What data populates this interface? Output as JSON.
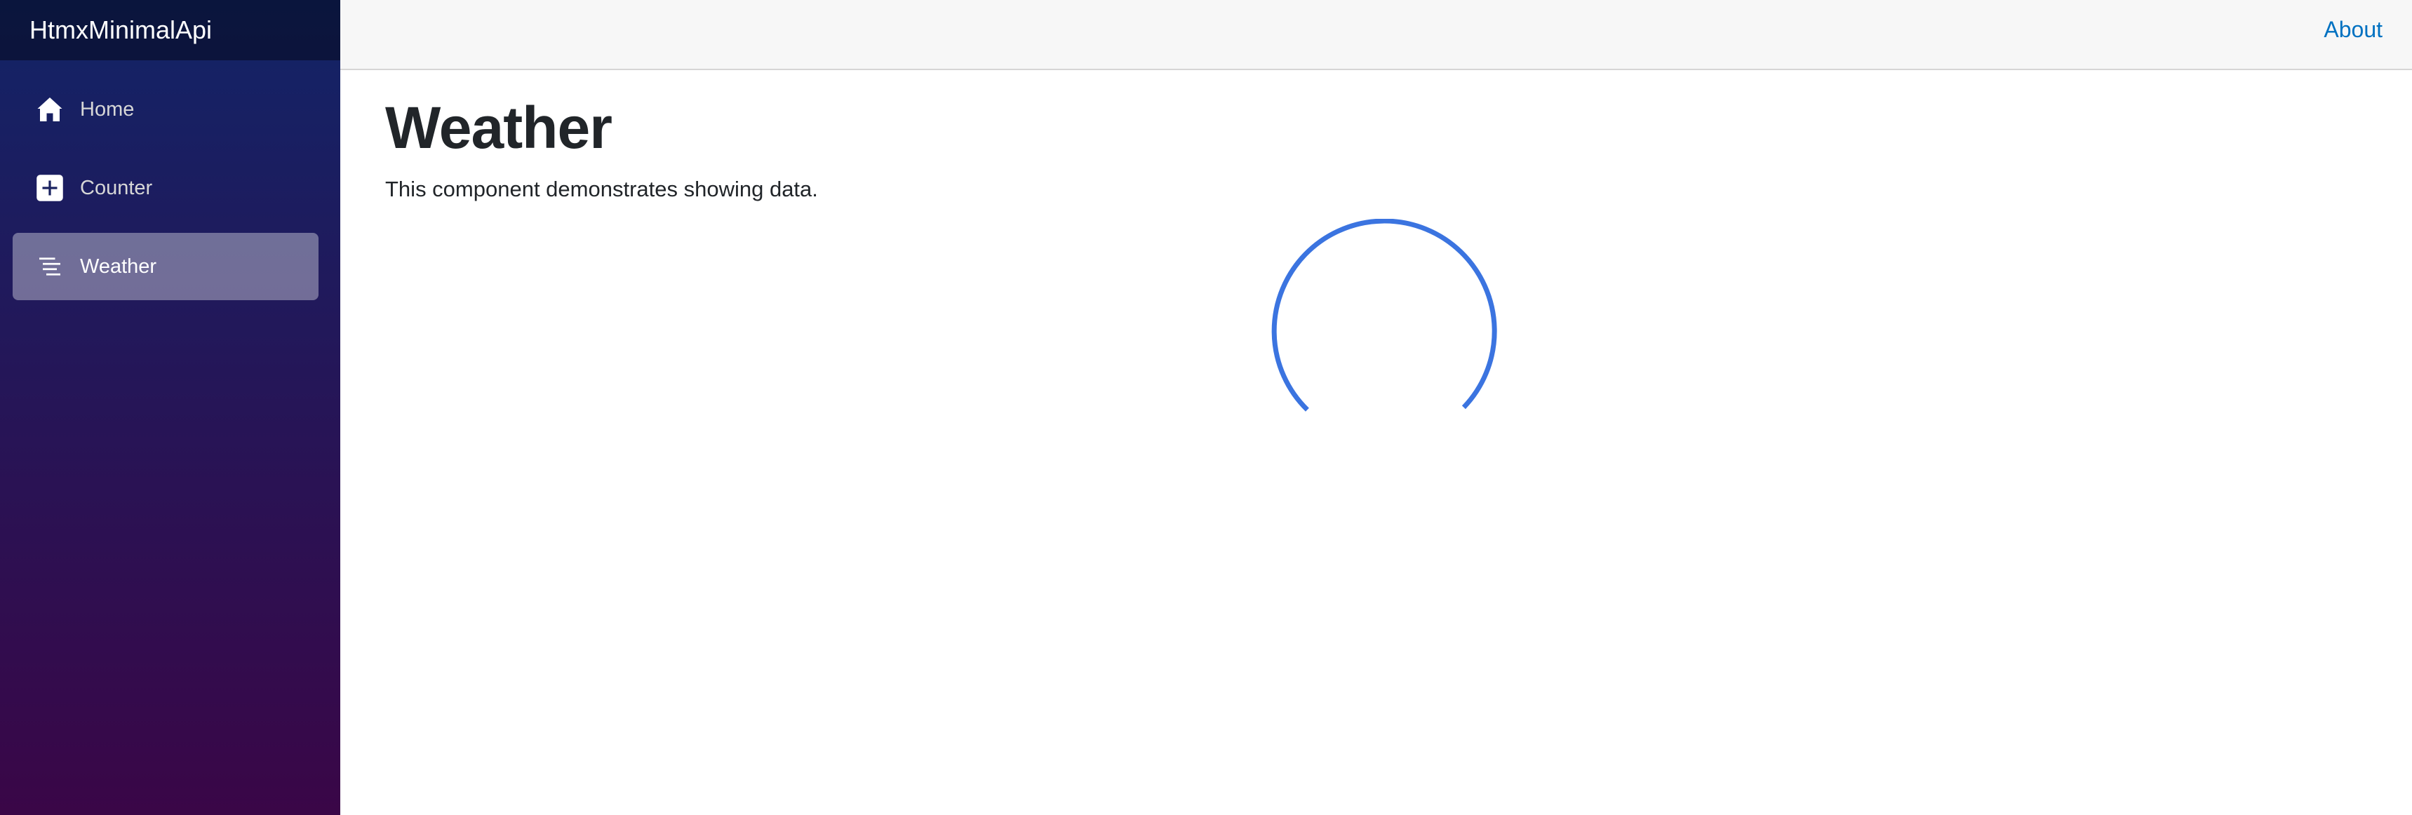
{
  "app": {
    "brand": "HtmxMinimalApi"
  },
  "sidebar": {
    "items": [
      {
        "label": "Home",
        "icon": "home-icon",
        "active": false
      },
      {
        "label": "Counter",
        "icon": "plus-square-icon",
        "active": false
      },
      {
        "label": "Weather",
        "icon": "list-icon",
        "active": true
      }
    ]
  },
  "header": {
    "about_label": "About"
  },
  "main": {
    "title": "Weather",
    "description": "This component demonstrates showing data."
  },
  "loading": {
    "icon": "loading-spinner-icon",
    "color": "#3b74e0"
  },
  "colors": {
    "sidebar_top": "#122467",
    "sidebar_bottom": "#3a0647",
    "link": "#0071c1"
  }
}
